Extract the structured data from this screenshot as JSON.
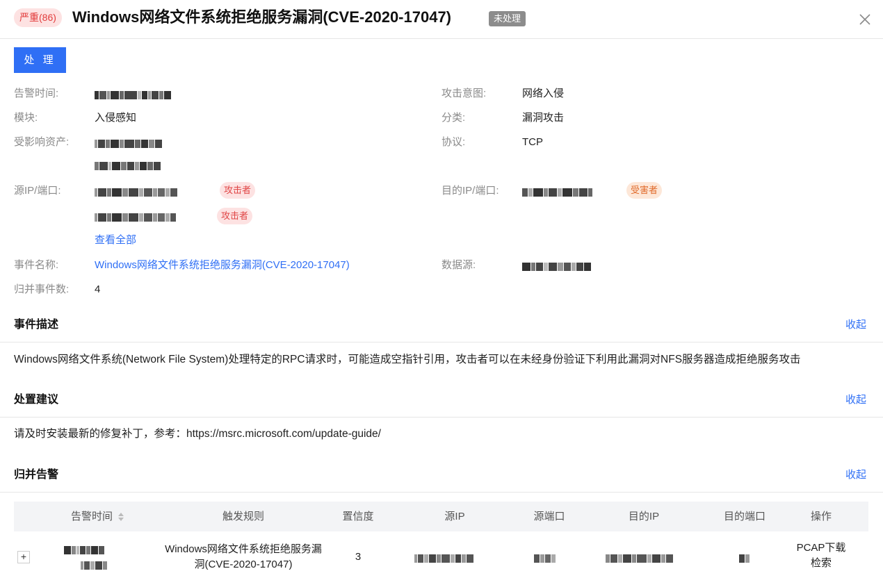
{
  "header": {
    "severity": "严重(86)",
    "title": "Windows网络文件系统拒绝服务漏洞(CVE-2020-17047)",
    "status": "未处理"
  },
  "actions": {
    "process_label": "处 理"
  },
  "details": {
    "alert_time_label": "告警时间:",
    "attack_intent_label": "攻击意图:",
    "attack_intent": "网络入侵",
    "module_label": "模块:",
    "module": "入侵感知",
    "category_label": "分类:",
    "category": "漏洞攻击",
    "affected_asset_label": "受影响资产:",
    "protocol_label": "协议:",
    "protocol": "TCP",
    "src_label": "源IP/端口:",
    "src_tags": [
      "攻击者",
      "攻击者"
    ],
    "dst_label": "目的IP/端口:",
    "dst_tag": "受害者",
    "view_all": "查看全部",
    "event_name_label": "事件名称:",
    "event_name": "Windows网络文件系统拒绝服务漏洞(CVE-2020-17047)",
    "data_source_label": "数据源:",
    "merged_count_label": "归并事件数:",
    "merged_count": "4"
  },
  "sections": {
    "collapse_label": "收起",
    "description_title": "事件描述",
    "description": "Windows网络文件系统(Network File System)处理特定的RPC请求时，可能造成空指针引用，攻击者可以在未经身份验证下利用此漏洞对NFS服务器造成拒绝服务攻击",
    "advice_title": "处置建议",
    "advice": "请及时安装最新的修复补丁，参考：https://msrc.microsoft.com/update-guide/",
    "merged_title": "归并告警"
  },
  "table": {
    "columns": [
      "告警时间",
      "触发规则",
      "置信度",
      "源IP",
      "源端口",
      "目的IP",
      "目的端口",
      "操作"
    ],
    "row": {
      "expand": "+",
      "rule_line1": "Windows网络文件系统拒绝服务漏",
      "rule_line2": "洞(CVE-2020-17047)",
      "confidence": "3",
      "action_pcap": "PCAP下载",
      "action_search": "检索"
    }
  },
  "colors": {
    "accent": "#2f6ff5",
    "danger": "#e23b3b",
    "warning": "#e06a2a"
  }
}
